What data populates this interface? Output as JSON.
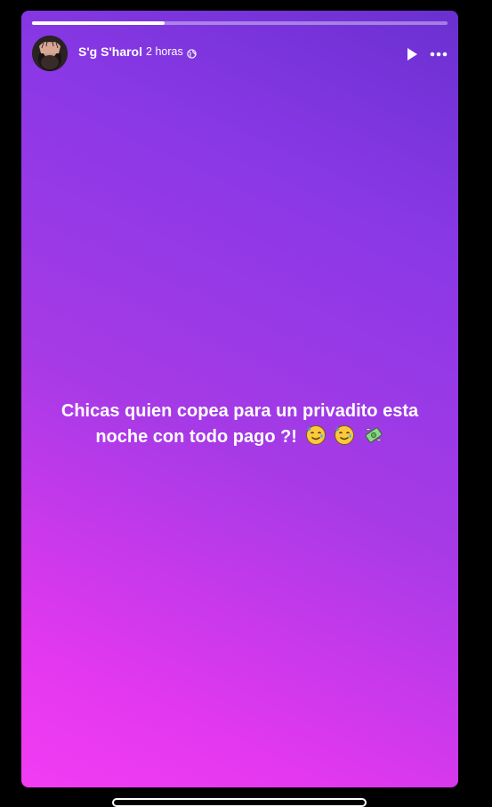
{
  "story": {
    "author_name": "S'g S'harol",
    "timestamp": "2 horas",
    "privacy_icon": "globe-icon",
    "progress": 0.32,
    "text_line1": "Chicas quien copea para un privadito esta",
    "text_line2": "noche con todo pago ?!",
    "emojis": [
      "smiling-face-with-tear",
      "smiling-face-with-tear",
      "money-with-wings"
    ]
  },
  "colors": {
    "gradient_top": "#6a30d0",
    "gradient_bottom": "#f23cf4",
    "text": "#ffffff",
    "background": "#000000"
  },
  "controls": {
    "play_icon": "play-icon",
    "more_icon": "more-options-icon"
  }
}
